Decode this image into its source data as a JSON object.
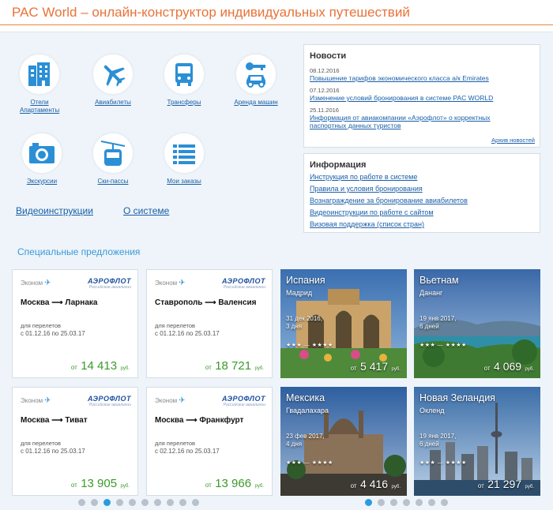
{
  "header": {
    "title": "PAC World – онлайн-конструктор индивидуальных путешествий"
  },
  "tiles": [
    {
      "label": "Отели Апартаменты",
      "icon": "hotel-icon"
    },
    {
      "label": "Авиабилеты",
      "icon": "airplane-icon"
    },
    {
      "label": "Трансферы",
      "icon": "bus-icon"
    },
    {
      "label": "Аренда машин",
      "icon": "car-key-icon"
    },
    {
      "label": "Экскурсии",
      "icon": "camera-icon"
    },
    {
      "label": "Ски-пассы",
      "icon": "ski-lift-icon"
    },
    {
      "label": "Мои заказы",
      "icon": "list-icon"
    }
  ],
  "links": {
    "video": "Видеоинструкции",
    "about": "О системе"
  },
  "news": {
    "title": "Новости",
    "items": [
      {
        "date": "08.12.2016",
        "text": "Повышение тарифов экономического класса а/к Emirates"
      },
      {
        "date": "07.12.2016",
        "text": "Изменение условий бронирования в системе PAC WORLD"
      },
      {
        "date": "25.11.2016",
        "text": "Информация от авиакомпании «Аэрофлот» о корректных паспортных данных туристов"
      }
    ],
    "archive": "Архив новостей"
  },
  "info": {
    "title": "Информация",
    "items": [
      "Инструкция по работе в системе",
      "Правила и условия бронирования",
      "Вознаграждение за бронирование авиабилетов",
      "Видеоинструкции по работе с сайтом",
      "Визовая поддержка (список стран)"
    ]
  },
  "specials": {
    "title": "Специальные предложения",
    "flights": [
      {
        "class": "Эконом",
        "airline": "АЭРОФЛОТ",
        "airline_sub": "Российские авиалинии",
        "route": "Москва ⟶ Ларнака",
        "note1": "для перелетов",
        "note2": "с 01.12.16 по 25.03.17",
        "from": "от",
        "price": "14 413",
        "currency": "руб."
      },
      {
        "class": "Эконом",
        "airline": "АЭРОФЛОТ",
        "airline_sub": "Российские авиалинии",
        "route": "Ставрополь ⟶ Валенсия",
        "note1": "для перелетов",
        "note2": "с 01.12.16 по 25.03.17",
        "from": "от",
        "price": "18 721",
        "currency": "руб."
      },
      {
        "class": "Эконом",
        "airline": "АЭРОФЛОТ",
        "airline_sub": "Российские авиалинии",
        "route": "Москва ⟶ Тиват",
        "note1": "для перелетов",
        "note2": "с 01.12.16 по 25.03.17",
        "from": "от",
        "price": "13 905",
        "currency": "руб."
      },
      {
        "class": "Эконом",
        "airline": "АЭРОФЛОТ",
        "airline_sub": "Российские авиалинии",
        "route": "Москва ⟶ Франкфурт",
        "note1": "для перелетов",
        "note2": "с 02.12.16 по 25.03.17",
        "from": "от",
        "price": "13 966",
        "currency": "руб."
      }
    ],
    "tours": [
      {
        "country": "Испания",
        "city": "Мадрид",
        "date": "31 дек 2016,",
        "days": "3 дня",
        "stars": "★★★ — ★★★★",
        "from": "от",
        "price": "5 417",
        "currency": "руб."
      },
      {
        "country": "Вьетнам",
        "city": "Дананг",
        "date": "19 янв 2017,",
        "days": "6 дней",
        "stars": "★★★ — ★★★★",
        "from": "от",
        "price": "4 069",
        "currency": "руб."
      },
      {
        "country": "Мексика",
        "city": "Гвадалахара",
        "date": "23 фев 2017,",
        "days": "4 дня",
        "stars": "★★★ — ★★★★",
        "from": "от",
        "price": "4 416",
        "currency": "руб."
      },
      {
        "country": "Новая Зеландия",
        "city": "Окленд",
        "date": "19 янв 2017,",
        "days": "6 дней",
        "stars": "★★★ — ★★★★",
        "from": "от",
        "price": "21 297",
        "currency": "руб."
      }
    ]
  },
  "carousels": {
    "flights": {
      "count": 10,
      "active": 2
    },
    "tours": {
      "count": 7,
      "active": 0
    }
  },
  "colors": {
    "accent": "#e8733a",
    "link": "#1a5fa8",
    "icon": "#2b8fd6",
    "price": "#3a9a2a",
    "dot_active": "#2b9be0"
  }
}
